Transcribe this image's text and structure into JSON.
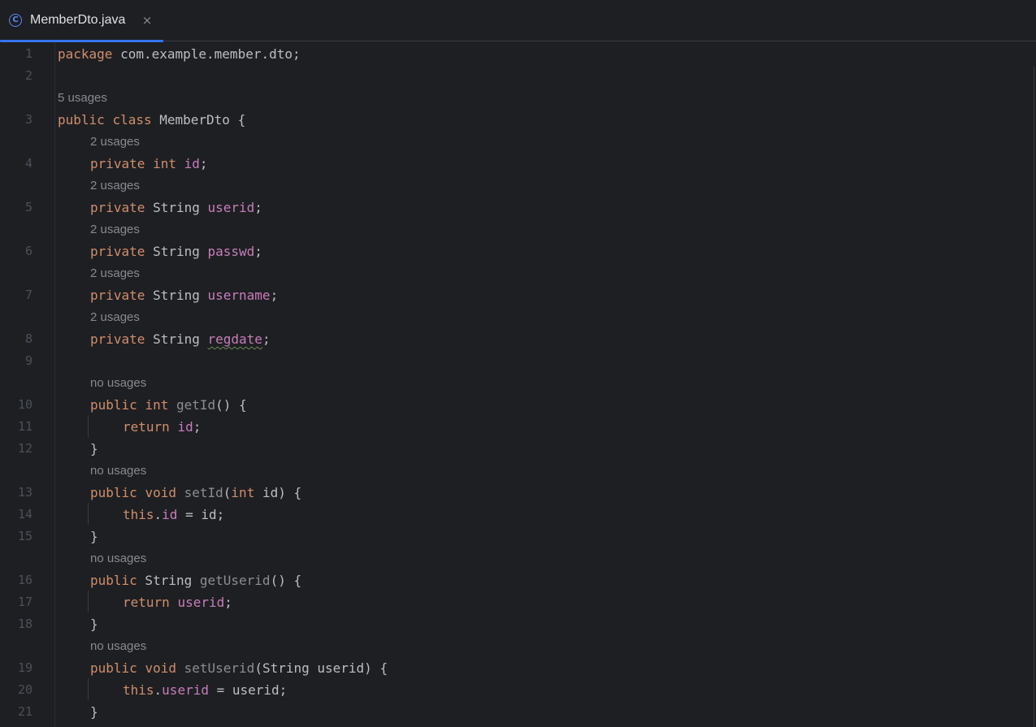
{
  "tab": {
    "icon": "class-icon",
    "icon_glyph": "C",
    "label": "MemberDto.java",
    "close_glyph": "×"
  },
  "hints": {
    "class_usages": "5 usages",
    "f1": "2 usages",
    "f2": "2 usages",
    "f3": "2 usages",
    "f4": "2 usages",
    "f5": "2 usages",
    "m1": "no usages",
    "m2": "no usages",
    "m3": "no usages",
    "m4": "no usages"
  },
  "line_numbers": [
    "1",
    "2",
    "3",
    "4",
    "5",
    "6",
    "7",
    "8",
    "9",
    "10",
    "11",
    "12",
    "13",
    "14",
    "15",
    "16",
    "17",
    "18",
    "19",
    "20",
    "21"
  ],
  "code": {
    "l1": {
      "kw": "package",
      "rest": " com.example.member.dto;"
    },
    "l3": {
      "kw1": "public",
      "kw2": "class",
      "rest": " MemberDto {"
    },
    "l4": {
      "kw1": "private",
      "kw2": "int",
      "field": "id",
      "end": ";"
    },
    "l5": {
      "kw1": "private",
      "type": " String ",
      "field": "userid",
      "end": ";"
    },
    "l6": {
      "kw1": "private",
      "type": " String ",
      "field": "passwd",
      "end": ";"
    },
    "l7": {
      "kw1": "private",
      "type": " String ",
      "field": "username",
      "end": ";"
    },
    "l8": {
      "kw1": "private",
      "type": " String ",
      "field": "regdate",
      "end": ";"
    },
    "l10": {
      "kw1": "public",
      "kw2": "int",
      "method": "getId",
      "end": "() {"
    },
    "l11": {
      "kw": "return",
      "field": "id",
      "end": ";"
    },
    "l12": {
      "text": "}"
    },
    "l13": {
      "kw1": "public",
      "kw2": "void",
      "method": "setId",
      "p1": "(",
      "pkw": "int",
      "end": " id) {"
    },
    "l14": {
      "kw": "this",
      "dot": ".",
      "field": "id",
      "end": " = id;"
    },
    "l15": {
      "text": "}"
    },
    "l16": {
      "kw1": "public",
      "type": " String ",
      "method": "getUserid",
      "end": "() {"
    },
    "l17": {
      "kw": "return",
      "field": "userid",
      "end": ";"
    },
    "l18": {
      "text": "}"
    },
    "l19": {
      "kw1": "public",
      "kw2": "void",
      "method": "setUserid",
      "end": "(String userid) {"
    },
    "l20": {
      "kw": "this",
      "dot": ".",
      "field": "userid",
      "end": " = userid;"
    },
    "l21": {
      "text": "}"
    }
  }
}
